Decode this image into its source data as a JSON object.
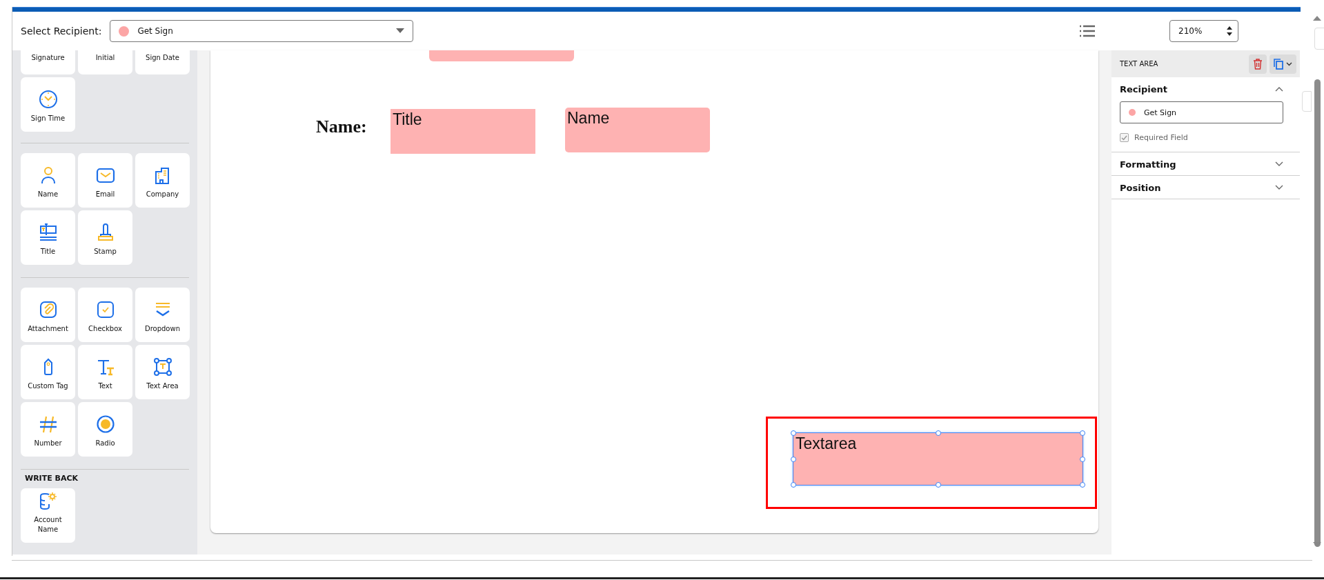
{
  "top_bar": {
    "label": "Select Recipient:",
    "recipient": {
      "name": "Get Sign",
      "color": "#fca5a5"
    },
    "zoom": "210%"
  },
  "sidebar": {
    "groups": [
      {
        "items": [
          {
            "label": "Signature"
          },
          {
            "label": "Initial"
          },
          {
            "label": "Sign Date"
          },
          {
            "label": "Sign Time",
            "kind": "clock"
          }
        ]
      },
      {
        "items": [
          {
            "label": "Name",
            "kind": "person"
          },
          {
            "label": "Email",
            "kind": "envelope"
          },
          {
            "label": "Company",
            "kind": "building"
          },
          {
            "label": "Title",
            "kind": "title"
          },
          {
            "label": "Stamp",
            "kind": "stamp"
          }
        ]
      },
      {
        "items": [
          {
            "label": "Attachment",
            "kind": "paperclip"
          },
          {
            "label": "Checkbox",
            "kind": "checkbox"
          },
          {
            "label": "Dropdown",
            "kind": "dropdown"
          },
          {
            "label": "Custom Tag",
            "kind": "tag"
          },
          {
            "label": "Text",
            "kind": "text"
          },
          {
            "label": "Text Area",
            "kind": "textarea"
          },
          {
            "label": "Number",
            "kind": "hash"
          },
          {
            "label": "Radio",
            "kind": "radio"
          }
        ]
      },
      {
        "heading": "WRITE BACK",
        "items": [
          {
            "label": "Account Name",
            "kind": "database"
          }
        ]
      }
    ]
  },
  "document": {
    "label": "Name:",
    "fields": [
      {
        "selected": false,
        "marked": false
      },
      {
        "text": "Title",
        "selected": false,
        "marked": false
      },
      {
        "text": "Name",
        "selected": false,
        "marked": false
      },
      {
        "text": "Textarea",
        "selected": true,
        "marked": true
      }
    ]
  },
  "properties": {
    "title": "TEXT AREA",
    "sections": [
      {
        "label": "Recipient",
        "expanded": true,
        "recipient": {
          "name": "Get Sign",
          "color": "#fca5a5"
        },
        "required": {
          "label": "Required Field",
          "checked": true,
          "disabled": true
        }
      },
      {
        "label": "Formatting",
        "expanded": false
      },
      {
        "label": "Position",
        "expanded": false
      }
    ]
  }
}
